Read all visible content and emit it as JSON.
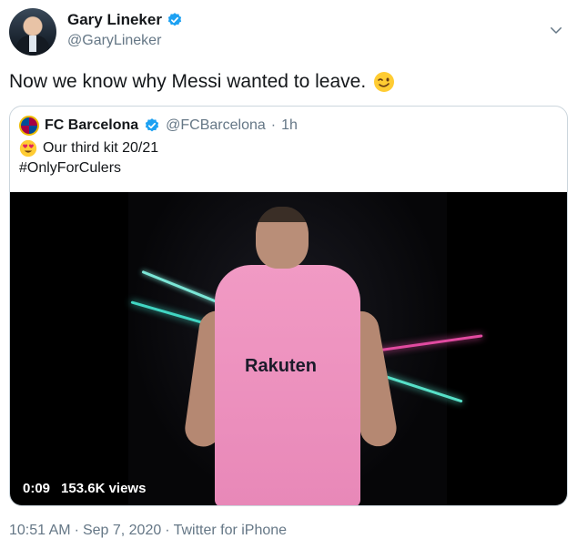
{
  "author": {
    "display_name": "Gary Lineker",
    "handle": "@GaryLineker"
  },
  "tweet": {
    "text": "Now we know why Messi wanted to leave.",
    "emoji": "winking-face"
  },
  "quoted": {
    "display_name": "FC Barcelona",
    "handle": "@FCBarcelona",
    "separator": "·",
    "time": "1h",
    "line1_emoji": "heart-eyes-face",
    "line1": "Our third kit 20/21",
    "line2": "#OnlyForCulers",
    "video": {
      "duration": "0:09",
      "views": "153.6K views",
      "sponsor_text": "Rakuten"
    }
  },
  "meta": {
    "time": "10:51 AM",
    "sep1": "·",
    "date": "Sep 7, 2020",
    "sep2": "·",
    "source": "Twitter for iPhone"
  },
  "colors": {
    "verified_blue": "#1da1f2",
    "secondary_text": "#657786",
    "border": "#ccd6dd"
  }
}
